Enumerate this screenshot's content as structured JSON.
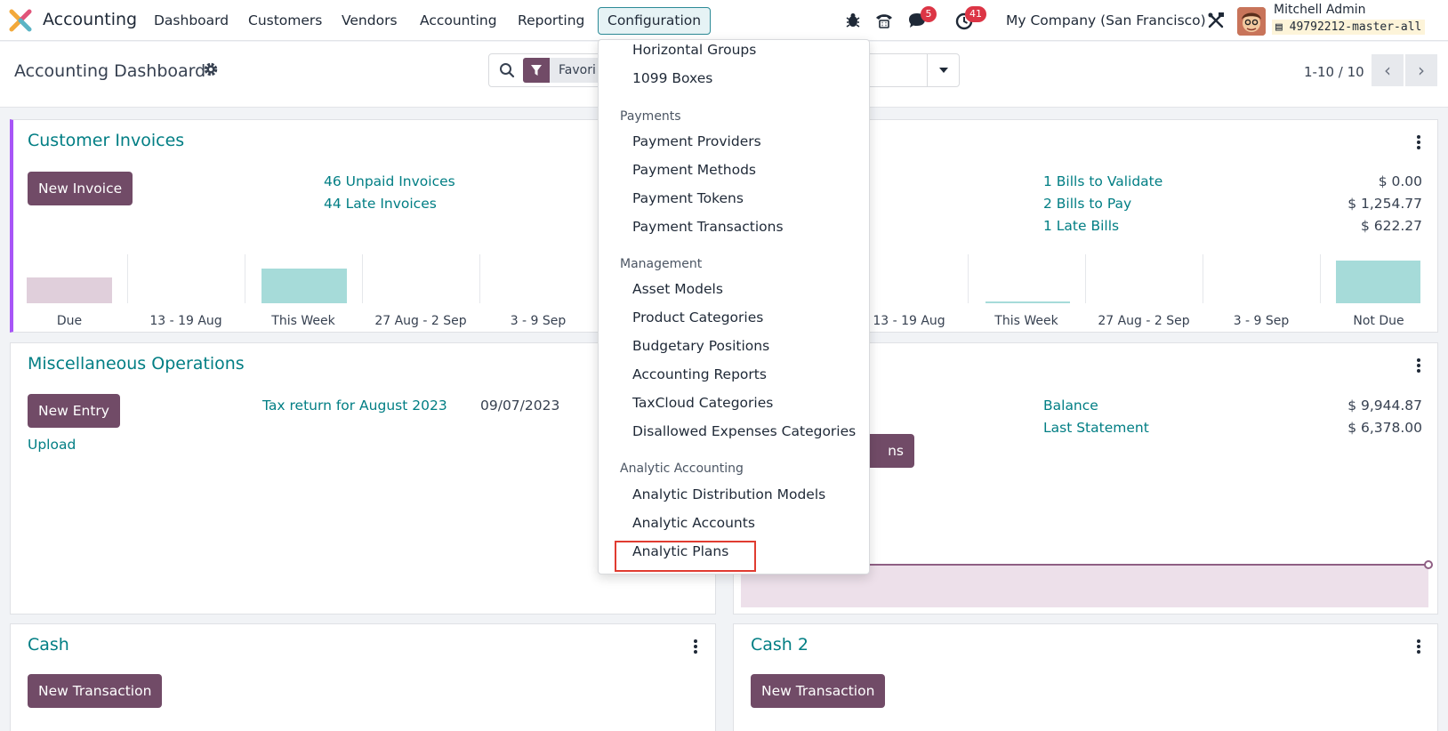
{
  "navbar": {
    "app_name": "Accounting",
    "menu": [
      "Dashboard",
      "Customers",
      "Vendors",
      "Accounting",
      "Reporting",
      "Configuration"
    ],
    "active_menu": "Configuration",
    "messages_badge": "5",
    "activities_badge": "41",
    "company": "My Company (San Francisco)",
    "user_name": "Mitchell Admin",
    "database": "49792212-master-all"
  },
  "control_panel": {
    "title": "Accounting Dashboard",
    "search_facet": "Favori",
    "pager": "1-10 / 10"
  },
  "customer_invoices": {
    "title": "Customer Invoices",
    "button": "New Invoice",
    "links": [
      "46 Unpaid Invoices",
      "44 Late Invoices"
    ],
    "graph_labels": [
      "Due",
      "13 - 19 Aug",
      "This Week",
      "27 Aug - 2 Sep",
      "3 - 9 Sep"
    ]
  },
  "vendor_bills": {
    "rows": [
      {
        "label": "1 Bills to Validate",
        "amount": "$ 0.00"
      },
      {
        "label": "2 Bills to Pay",
        "amount": "$ 1,254.77"
      },
      {
        "label": "1 Late Bills",
        "amount": "$ 622.27"
      }
    ],
    "graph_labels": [
      "13 - 19 Aug",
      "This Week",
      "27 Aug - 2 Sep",
      "3 - 9 Sep",
      "Not Due"
    ]
  },
  "misc_operations": {
    "title": "Miscellaneous Operations",
    "button": "New Entry",
    "upload": "Upload",
    "entry_label": "Tax return for August 2023",
    "entry_date": "09/07/2023"
  },
  "bank": {
    "button_partial": "ns",
    "rows": [
      {
        "label": "Balance",
        "amount": "$ 9,944.87"
      },
      {
        "label": "Last Statement",
        "amount": "$ 6,378.00"
      }
    ]
  },
  "cash": {
    "title": "Cash",
    "button": "New Transaction"
  },
  "cash2": {
    "title": "Cash 2",
    "button": "New Transaction"
  },
  "dropdown": {
    "items_top": [
      "Horizontal Groups",
      "1099 Boxes"
    ],
    "payments_header": "Payments",
    "payments": [
      "Payment Providers",
      "Payment Methods",
      "Payment Tokens",
      "Payment Transactions"
    ],
    "management_header": "Management",
    "management": [
      "Asset Models",
      "Product Categories",
      "Budgetary Positions",
      "Accounting Reports",
      "TaxCloud Categories",
      "Disallowed Expenses Categories"
    ],
    "analytic_header": "Analytic Accounting",
    "analytic": [
      "Analytic Distribution Models",
      "Analytic Accounts",
      "Analytic Plans"
    ]
  },
  "colors": {
    "brand": "#714b67",
    "link": "#017e84",
    "bar_teal": "#a6dbd9",
    "bar_pink": "#e0cfdb",
    "highlight": "#e03c31"
  }
}
